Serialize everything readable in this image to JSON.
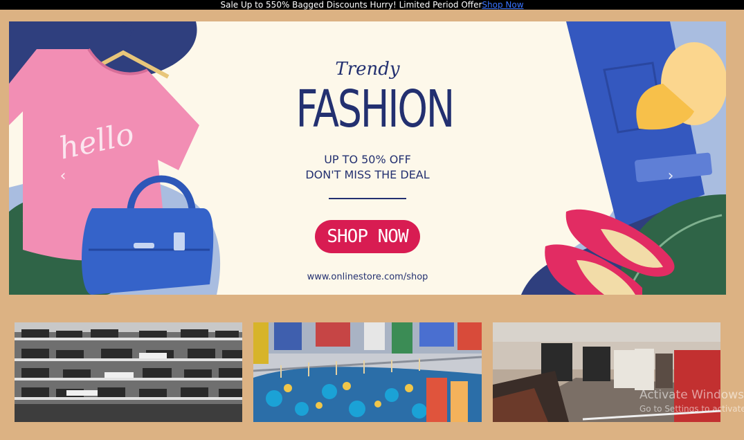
{
  "top_banner": {
    "text": "Sale Up to 550% Bagged Discounts Hurry! Limited Period Offer",
    "link_label": "Shop Now"
  },
  "carousel": {
    "slide": {
      "script_title": "Trendy",
      "title": "FASHION",
      "offer_line1": "UP TO 50% OFF",
      "offer_line2": "DON'T MISS THE DEAL",
      "cta_label": "SHOP NOW",
      "url": "www.onlinestore.com/shop",
      "shirt_text": "hello"
    },
    "prev_icon": "‹",
    "next_icon": "›"
  },
  "thumbnails": [
    {
      "icon": "store-shelves-photo"
    },
    {
      "icon": "clothing-rack-photo"
    },
    {
      "icon": "store-interior-photo"
    }
  ],
  "watermark": {
    "line1": "Activate Windows",
    "line2": "Go to Settings to activate"
  },
  "colors": {
    "page_bg": "#dcb283",
    "banner_bg": "#fdf8ea",
    "navy": "#233070",
    "cta": "#d81c52"
  }
}
